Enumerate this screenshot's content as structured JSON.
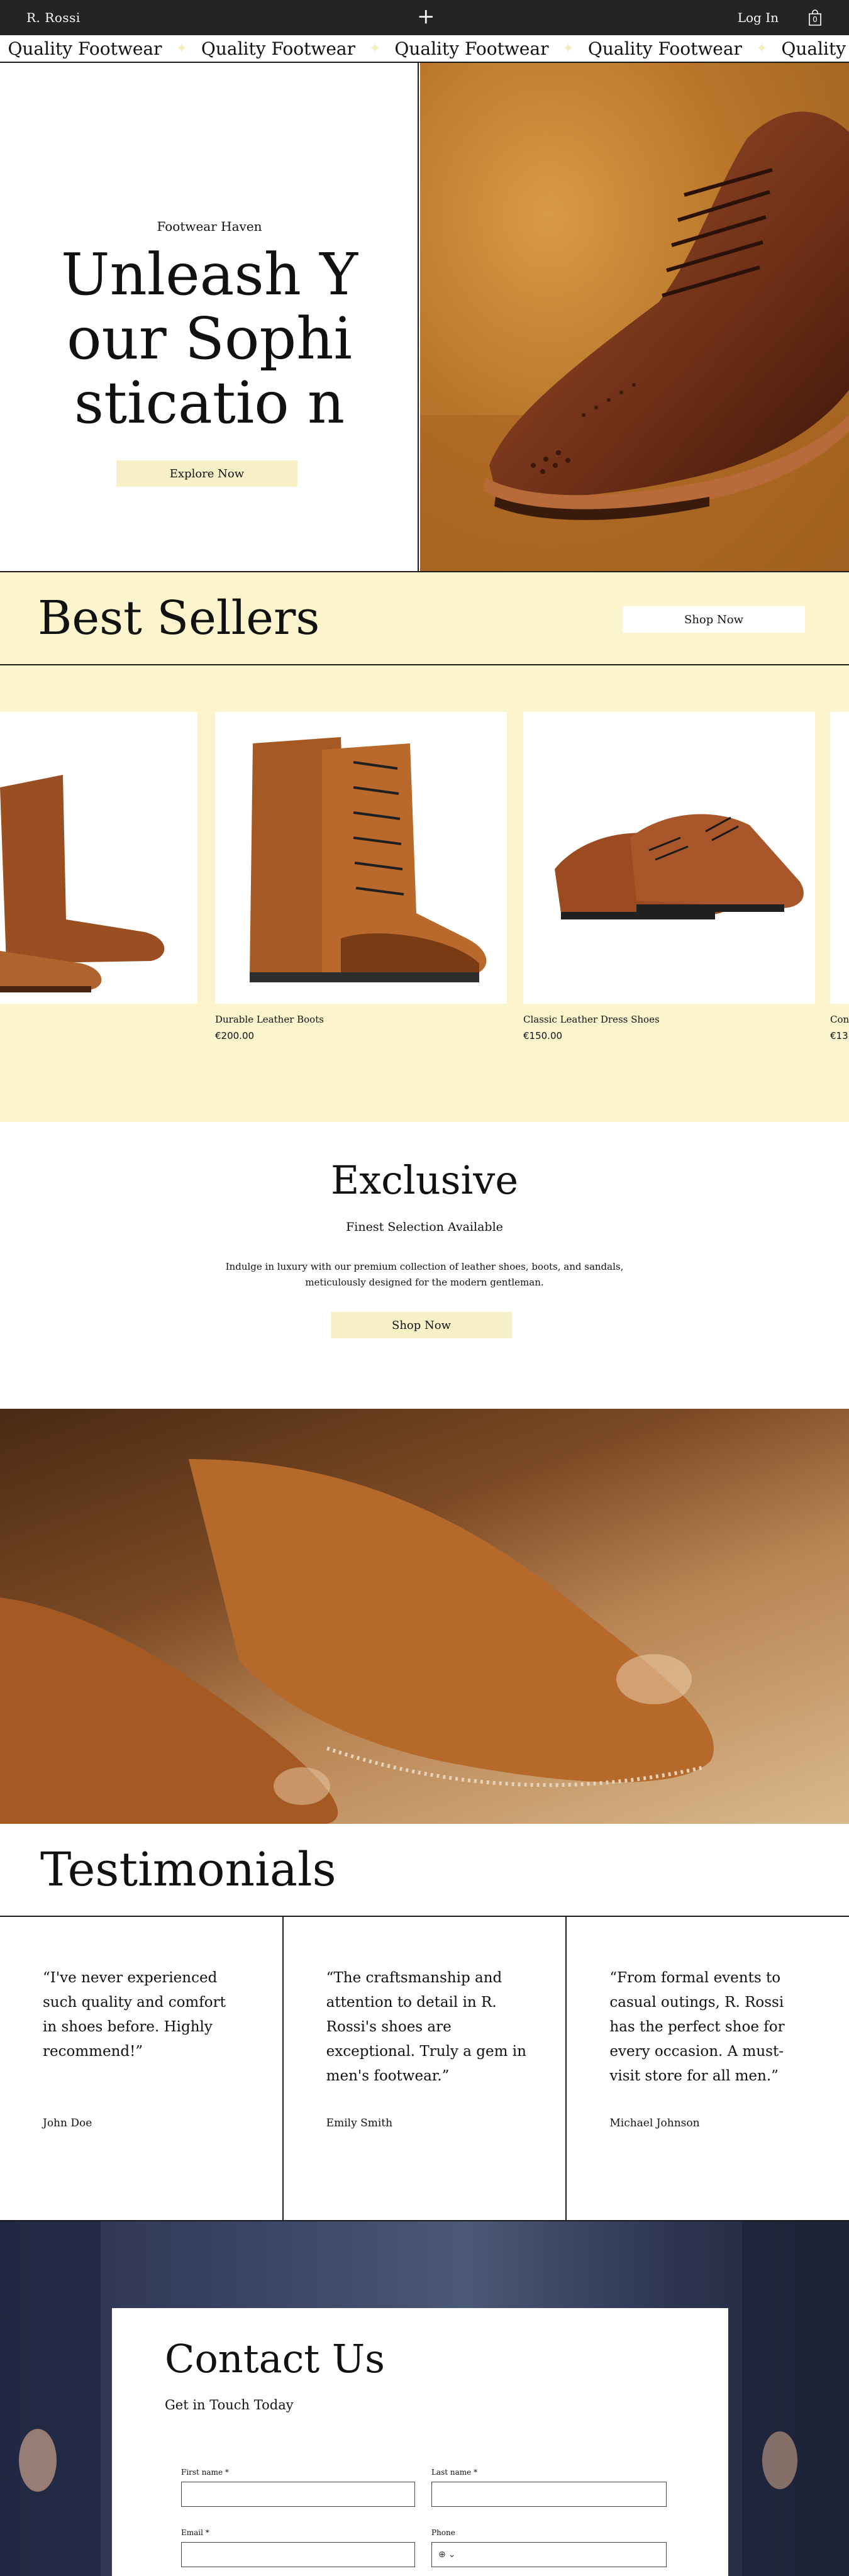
{
  "nav": {
    "brand": "R. Rossi",
    "plus": "+",
    "login": "Log In",
    "cart_count": "0"
  },
  "marquee": {
    "items": [
      "Quality Footwear",
      "Quality Footwear",
      "Quality Footwear",
      "Quality Footwear",
      "Quality Footwear"
    ]
  },
  "hero": {
    "eyebrow": "Footwear Haven",
    "title": "Unleash Your Sophisticatio n",
    "button": "Explore Now"
  },
  "best_sellers": {
    "title": "Best Sellers",
    "button": "Shop Now",
    "products": [
      {
        "name": "",
        "price": ""
      },
      {
        "name": "Durable Leather Boots",
        "price": "€200.00"
      },
      {
        "name": "Classic Leather Dress Shoes",
        "price": "€150.00"
      },
      {
        "name": "Con",
        "price": "€13"
      }
    ]
  },
  "exclusive": {
    "title": "Exclusive",
    "subtitle": "Finest Selection Available",
    "body": "Indulge in luxury with our premium collection of leather shoes, boots, and sandals, meticulously designed for the modern gentleman.",
    "button": "Shop Now"
  },
  "testimonials": {
    "title": "Testimonials",
    "items": [
      {
        "quote": "“I've never experienced such quality and comfort in shoes before. Highly recommend!”",
        "author": "John Doe"
      },
      {
        "quote": "“The craftsmanship and attention to detail in R. Rossi's shoes are exceptional. Truly a gem in men's footwear.”",
        "author": "Emily Smith"
      },
      {
        "quote": "“From formal events to casual outings, R. Rossi has the perfect shoe for every occasion. A must-visit store for all men.”",
        "author": "Michael Johnson"
      }
    ]
  },
  "contact": {
    "title": "Contact Us",
    "subtitle": "Get in Touch Today",
    "fields": {
      "first_name": "First name *",
      "last_name": "Last name *",
      "email": "Email *",
      "phone": "Phone"
    }
  },
  "colors": {
    "accent_cream": "#f8f1c8",
    "section_cream": "#fbf4cc",
    "topbar": "#242424"
  }
}
